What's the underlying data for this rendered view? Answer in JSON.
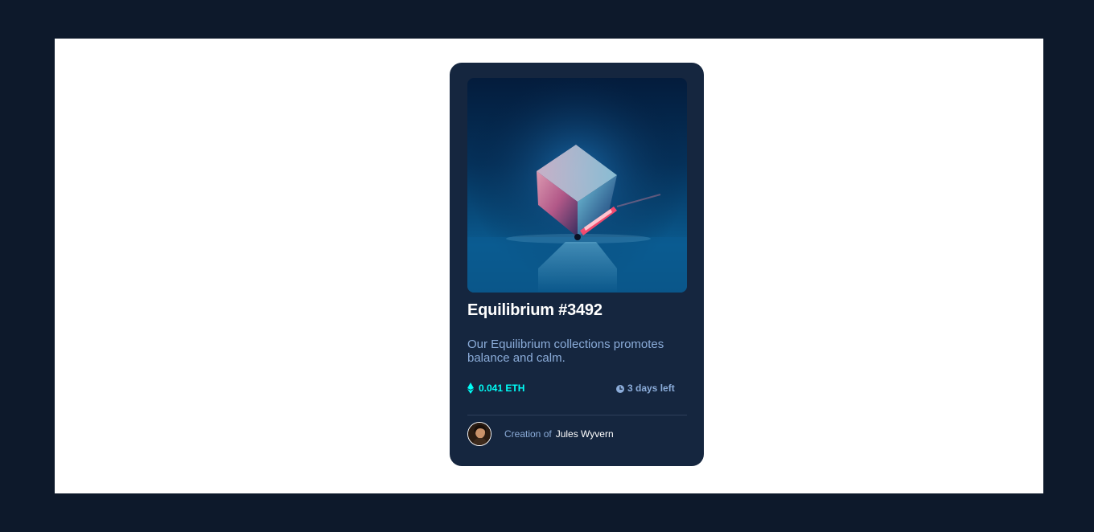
{
  "card": {
    "title": "Equilibrium #3492",
    "description": "Our Equilibrium collections promotes balance and calm.",
    "price": "0.041 ETH",
    "time_left": "3 days left",
    "creator_prefix": "Creation of",
    "creator_name": "Jules Wyvern"
  },
  "icons": {
    "price": "ethereum-icon",
    "time": "clock-icon"
  },
  "colors": {
    "page_background": "#0d192b",
    "card_background": "#15263f",
    "accent_cyan": "#00fff8",
    "soft_blue": "#8bacd9",
    "white": "#ffffff"
  }
}
